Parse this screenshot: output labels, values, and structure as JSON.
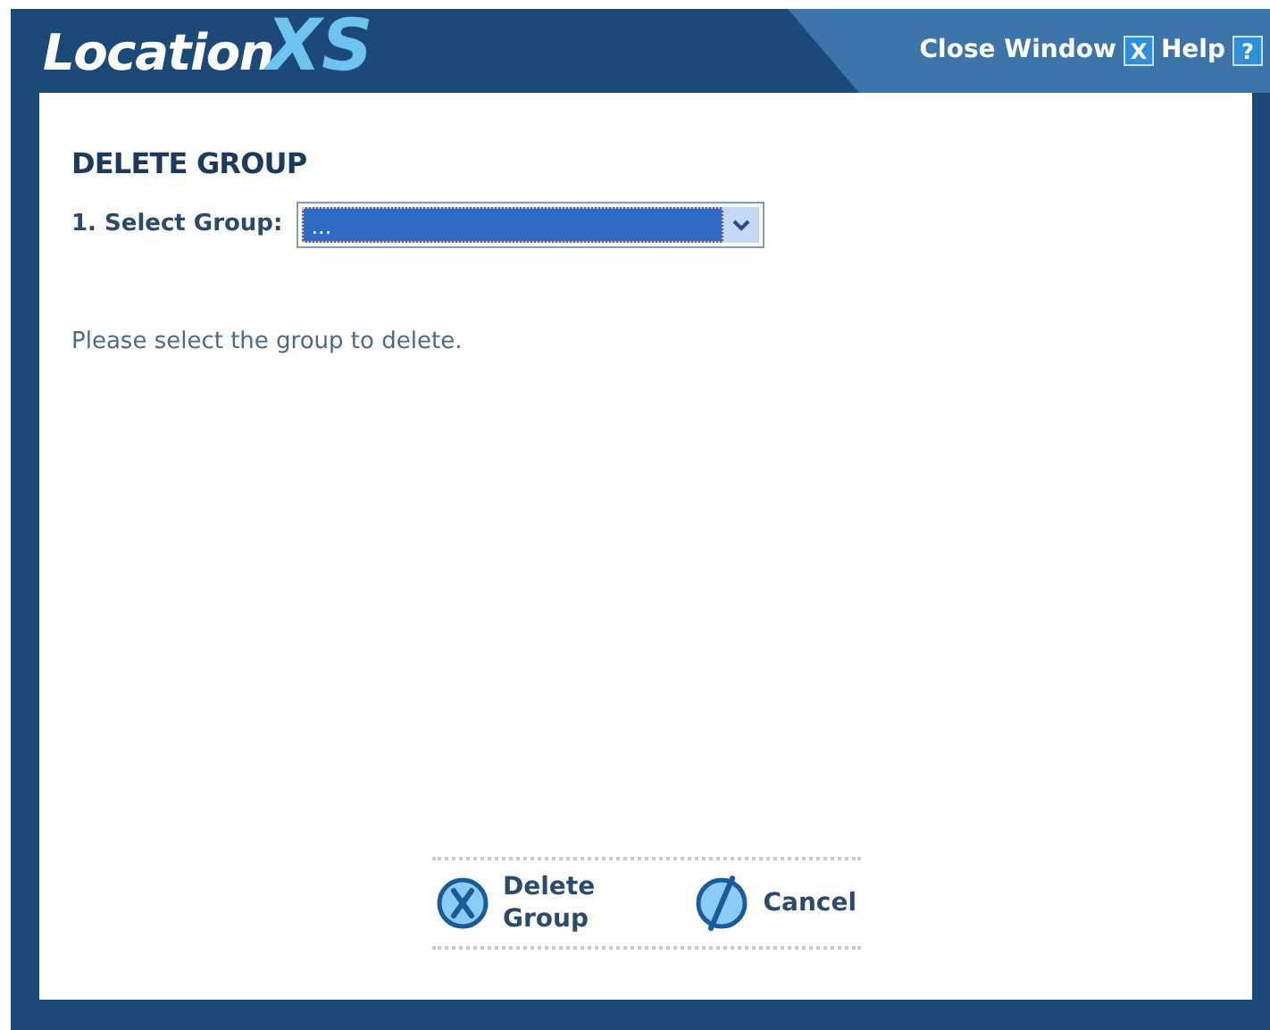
{
  "logo": {
    "word": "Location",
    "mark": "XS"
  },
  "header_links": [
    {
      "label": "Close Window",
      "icon": "X"
    },
    {
      "label": "Help",
      "icon": "?"
    }
  ],
  "title": "DELETE GROUP",
  "form": {
    "label": "1. Select Group:",
    "select": {
      "value": "...",
      "selected": true
    }
  },
  "message": "Please select the group to delete.",
  "buttons": [
    {
      "label": "Delete Group",
      "kind": "delete"
    },
    {
      "label": "Cancel",
      "kind": "cancel"
    }
  ]
}
